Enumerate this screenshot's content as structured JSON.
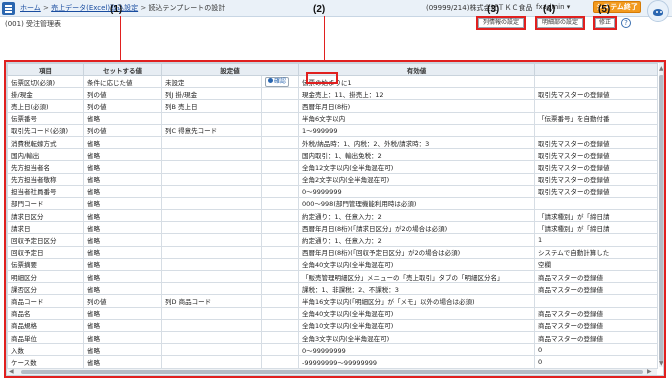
{
  "topbar": {
    "breadcrumbs": [
      {
        "label": "ホーム",
        "link": true
      },
      {
        "label": "売上データ(Excel)取込設定",
        "link": true
      },
      {
        "label": "読込テンプレートの設計",
        "link": false
      }
    ],
    "company": "(09999/214)株式会社ＴＫＣ食品",
    "user": "fxadmin ▾",
    "exit_label": "システム終了"
  },
  "subtitle": "(001) 受注管理表",
  "buttons": {
    "column_info": "列情報の設定",
    "detail": "明細部の設定",
    "fix": "修正",
    "help": "?"
  },
  "callouts": [
    "(1)",
    "(2)",
    "(3)",
    "(4)",
    "(5)"
  ],
  "table": {
    "headers": [
      "項目",
      "セットする値",
      "設定値",
      "",
      "有効値",
      ""
    ],
    "confirm_label": "確認",
    "rows": [
      [
        "伝票区切(必須)",
        "条件に応じた値",
        "未設定",
        "confirm",
        "伝票の始まりに1",
        ""
      ],
      [
        "掛/現金",
        "列の値",
        "列J 掛/現金",
        "",
        "現金売上：11、掛売上：12",
        "取引先マスターの登録値"
      ],
      [
        "売上日(必須)",
        "列の値",
        "列B 売上日",
        "",
        "西暦年月日(8桁)",
        ""
      ],
      [
        "伝票番号",
        "省略",
        "",
        "",
        "半角6文字以内",
        "「伝票番号」を自動付番"
      ],
      [
        "取引先コード(必須)",
        "列の値",
        "列C 得意先コード",
        "",
        "1～999999",
        ""
      ],
      [
        "消費税転嫁方式",
        "省略",
        "",
        "",
        "外税/納品時：1、内税：2、外税/請求時：3",
        "取引先マスターの登録値"
      ],
      [
        "国内/輸出",
        "省略",
        "",
        "",
        "国内取引：1、輸出免税：2",
        "取引先マスターの登録値"
      ],
      [
        "先方担当者名",
        "省略",
        "",
        "",
        "全角12文字以内(全半角混在可)",
        "取引先マスターの登録値"
      ],
      [
        "先方担当者敬称",
        "省略",
        "",
        "",
        "全角2文字以内(全半角混在可)",
        "取引先マスターの登録値"
      ],
      [
        "担当者社員番号",
        "省略",
        "",
        "",
        "0～9999999",
        "取引先マスターの登録値"
      ],
      [
        "部門コード",
        "省略",
        "",
        "",
        "000～998(部門管理機能利用時は必須)",
        ""
      ],
      [
        "請求日区分",
        "省略",
        "",
        "",
        "約定通り：1、任意入力：2",
        "「請求種別」が「締日請"
      ],
      [
        "請求日",
        "省略",
        "",
        "",
        "西暦年月日(8桁)(「請求日区分」が2の場合は必須)",
        "「請求種別」が「締日請"
      ],
      [
        "回収予定日区分",
        "省略",
        "",
        "",
        "約定通り：1、任意入力：2",
        "1"
      ],
      [
        "回収予定日",
        "省略",
        "",
        "",
        "西暦年月日(8桁)(「回収予定日区分」が2の場合は必須)",
        "システムで自動計算した"
      ],
      [
        "伝票摘要",
        "省略",
        "",
        "",
        "全角40文字以内(全半角混在可)",
        "空欄"
      ],
      [
        "明細区分",
        "省略",
        "",
        "",
        "「販売管理明細区分」メニューの「売上取引」タブの「明細区分名」",
        "商品マスターの登録値"
      ],
      [
        "課否区分",
        "省略",
        "",
        "",
        "課税：1、非課税：2、不課税：3",
        "商品マスターの登録値"
      ],
      [
        "商品コード",
        "列の値",
        "列D 商品コード",
        "",
        "半角16文字以内(「明細区分」が「メモ」以外の場合は必須)",
        ""
      ],
      [
        "商品名",
        "省略",
        "",
        "",
        "全角40文字以内(全半角混在可)",
        "商品マスターの登録値"
      ],
      [
        "商品規格",
        "省略",
        "",
        "",
        "全角10文字以内(全半角混在可)",
        "商品マスターの登録値"
      ],
      [
        "商品単位",
        "省略",
        "",
        "",
        "全角3文字以内(全半角混在可)",
        "商品マスターの登録値"
      ],
      [
        "入数",
        "省略",
        "",
        "",
        "0～99999999",
        "0"
      ],
      [
        "ケース数",
        "省略",
        "",
        "",
        "-99999999～99999999",
        "0"
      ]
    ]
  }
}
